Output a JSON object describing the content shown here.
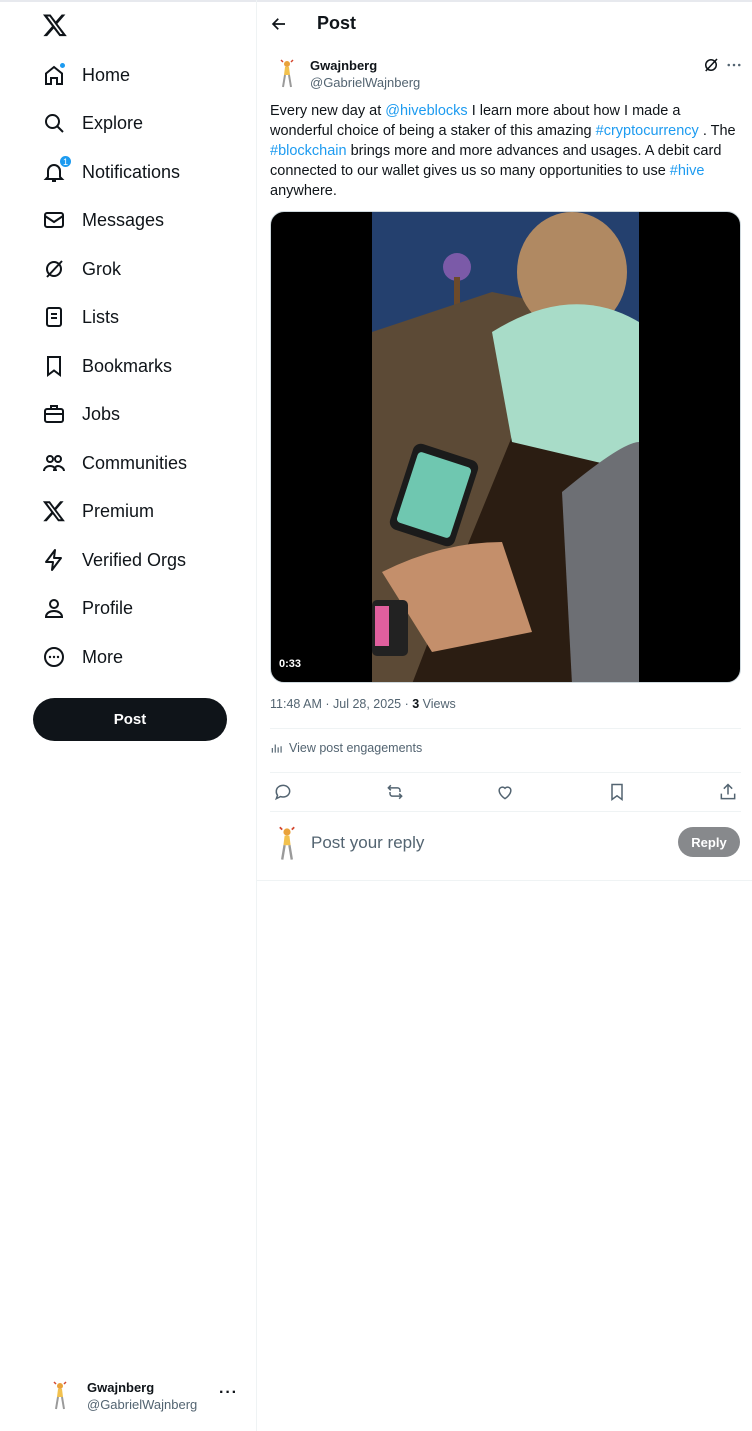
{
  "sidebar": {
    "logo_icon": "x-logo-icon",
    "nav": [
      {
        "label": "Home",
        "icon": "home-icon"
      },
      {
        "label": "Explore",
        "icon": "search-icon"
      },
      {
        "label": "Notifications",
        "icon": "bell-icon",
        "badge": "1"
      },
      {
        "label": "Messages",
        "icon": "mail-icon"
      },
      {
        "label": "Grok",
        "icon": "grok-icon"
      },
      {
        "label": "Lists",
        "icon": "list-icon"
      },
      {
        "label": "Bookmarks",
        "icon": "bookmark-icon"
      },
      {
        "label": "Jobs",
        "icon": "briefcase-icon"
      },
      {
        "label": "Communities",
        "icon": "people-icon"
      },
      {
        "label": "Premium",
        "icon": "x-logo-icon"
      },
      {
        "label": "Verified Orgs",
        "icon": "lightning-icon"
      },
      {
        "label": "Profile",
        "icon": "person-icon"
      },
      {
        "label": "More",
        "icon": "more-circle-icon"
      }
    ],
    "post_button": "Post",
    "account": {
      "name": "Gwajnberg",
      "handle": "@GabrielWajnberg"
    }
  },
  "header": {
    "title": "Post"
  },
  "tweet": {
    "author_name": "Gwajnberg",
    "author_handle": "@GabrielWajnberg",
    "text_parts": [
      {
        "t": "Every new day at ",
        "link": false
      },
      {
        "t": "@hiveblocks",
        "link": true
      },
      {
        "t": " I learn more about how I made a wonderful choice of being a staker of this amazing ",
        "link": false
      },
      {
        "t": "#cryptocurrency",
        "link": true
      },
      {
        "t": " . The ",
        "link": false
      },
      {
        "t": "#blockchain",
        "link": true
      },
      {
        "t": " brings more and more advances and usages. A debit card connected to our wallet gives us so many opportunities to use ",
        "link": false
      },
      {
        "t": "#hive",
        "link": true
      },
      {
        "t": " anywhere.",
        "link": false
      }
    ],
    "video_duration": "0:33",
    "time": "11:48 AM",
    "date": "Jul 28, 2025",
    "views_count": "3",
    "views_label": "Views",
    "engagements_label": "View post engagements"
  },
  "actions": [
    "reply-icon",
    "repost-icon",
    "like-icon",
    "bookmark-icon",
    "share-icon"
  ],
  "reply": {
    "placeholder": "Post your reply",
    "button": "Reply"
  },
  "colors": {
    "accent": "#1d9bf0",
    "text": "#0f1419",
    "muted": "#536471",
    "post_button": "#0f1419",
    "reply_button_disabled": "#87898c"
  }
}
